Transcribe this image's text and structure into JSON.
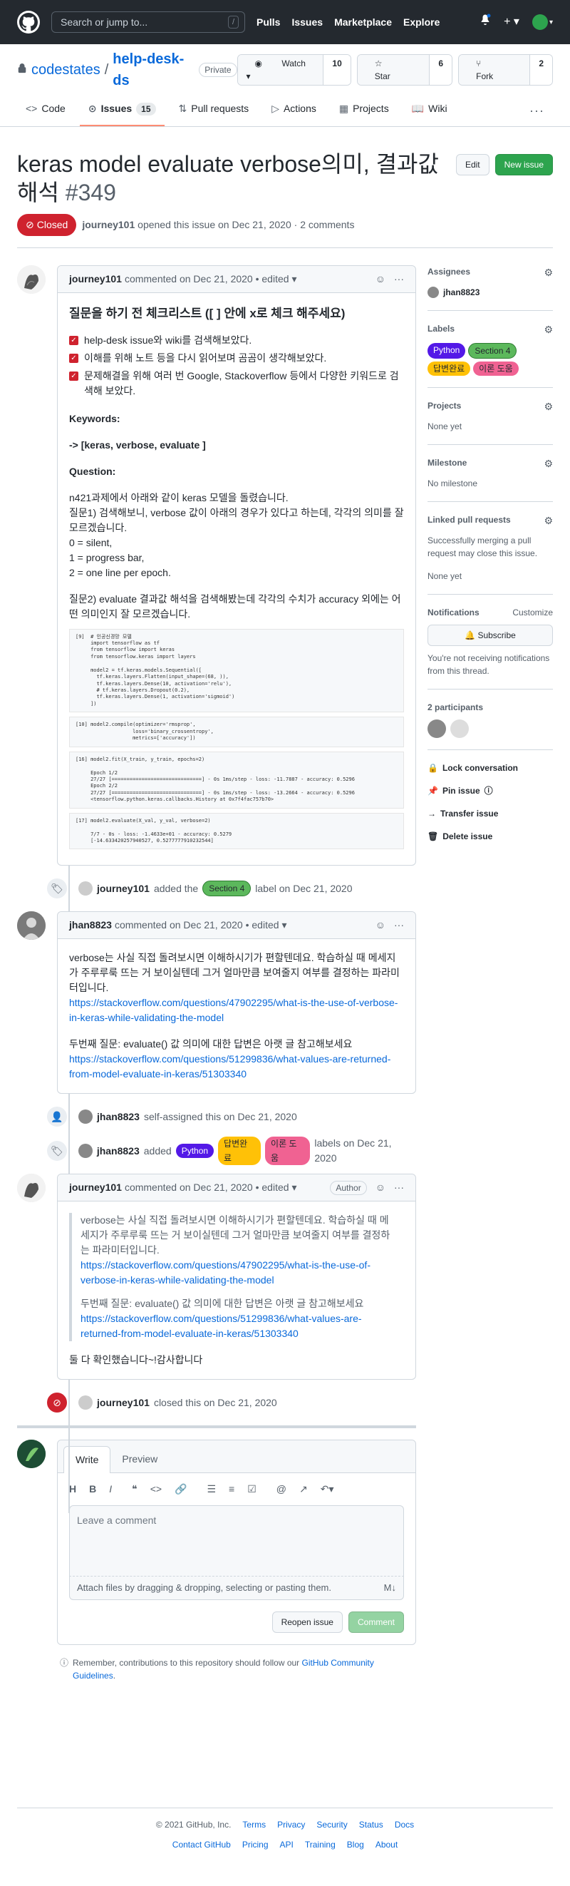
{
  "header": {
    "search_placeholder": "Search or jump to...",
    "slash": "/",
    "nav": [
      "Pulls",
      "Issues",
      "Marketplace",
      "Explore"
    ]
  },
  "repo": {
    "owner": "codestates",
    "sep": "/",
    "name": "help-desk-ds",
    "visibility": "Private",
    "watch_label": "Watch",
    "watch_count": "10",
    "star_label": "Star",
    "star_count": "6",
    "fork_label": "Fork",
    "fork_count": "2",
    "tabs": [
      {
        "label": "Code",
        "icon": "code-icon"
      },
      {
        "label": "Issues",
        "icon": "issue-icon",
        "counter": "15"
      },
      {
        "label": "Pull requests",
        "icon": "pull-request-icon"
      },
      {
        "label": "Actions",
        "icon": "play-icon"
      },
      {
        "label": "Projects",
        "icon": "project-icon"
      },
      {
        "label": "Wiki",
        "icon": "book-icon"
      }
    ]
  },
  "issue": {
    "title": "keras model evaluate verbose의미, 결과값 해석",
    "number": "#349",
    "edit_label": "Edit",
    "new_issue_label": "New issue",
    "state": "Closed",
    "author": "journey101",
    "opened_text": "opened this issue on Dec 21, 2020 · 2 comments"
  },
  "comments": {
    "first": {
      "author": "journey101",
      "meta": "commented on Dec 21, 2020 • edited",
      "heading": "질문을 하기 전 체크리스트 ([ ] 안에 x로 체크 해주세요)",
      "tasks": [
        "help-desk issue와 wiki를 검색해보았다.",
        "이해를 위해 노트 등을 다시 읽어보며 곰곰이 생각해보았다.",
        "문제해결을 위해 여러 번 Google, Stackoverflow 등에서 다양한 키워드로 검색해 보았다."
      ],
      "keywords_h": "Keywords:",
      "keywords": "-> [keras, verbose, evaluate ]",
      "question_h": "Question:",
      "q_lines": [
        "n421과제에서 아래와 같이 keras 모델을 돌렸습니다.",
        "질문1) 검색해보니, verbose 값이 아래의 경우가 있다고 하는데, 각각의 의미를 잘 모르겠습니다.",
        "0 = silent,",
        "1 = progress bar,",
        "2 = one line per epoch."
      ],
      "q2": "질문2) evaluate 결과값 해석을 검색해봤는데 각각의 수치가 accuracy 외에는 어떤 의미인지 잘 모르겠습니다."
    },
    "second": {
      "author": "jhan8823",
      "meta": "commented on Dec 21, 2020 • edited",
      "p1": "verbose는 사실 직접 돌려보시면 이해하시기가 편할텐데요. 학습하실 때 메세지가 주루루룩 뜨는 거 보이실텐데 그거 얼마만큼 보여줄지 여부를 결정하는 파라미터입니다.",
      "link1": "https://stackoverflow.com/questions/47902295/what-is-the-use-of-verbose-in-keras-while-validating-the-model",
      "p2": "두번째 질문: evaluate() 값 의미에 대한 답변은 아랫 글 참고해보세요",
      "link2": "https://stackoverflow.com/questions/51299836/what-values-are-returned-from-model-evaluate-in-keras/51303340"
    },
    "third": {
      "author": "journey101",
      "meta": "commented on Dec 21, 2020 • edited",
      "badge": "Author",
      "q1": "verbose는 사실 직접 돌려보시면 이해하시기가 편할텐데요. 학습하실 때 메세지가 주루루룩 뜨는 거 보이실텐데 그거 얼마만큼 보여줄지 여부를 결정하는 파라미터입니다.",
      "qlink1": "https://stackoverflow.com/questions/47902295/what-is-the-use-of-verbose-in-keras-while-validating-the-model",
      "q2": "두번째 질문: evaluate() 값 의미에 대한 답변은 아랫 글 참고해보세요",
      "qlink2": "https://stackoverflow.com/questions/51299836/what-values-are-returned-from-model-evaluate-in-keras/51303340",
      "reply": "둘 다 확인했습니다~!감사합니다"
    }
  },
  "code": {
    "cell1": [
      "[9]  # 인공신경망 모델",
      "     import tensorflow as tf",
      "     from tensorflow import keras",
      "     from tensorflow.keras import layers",
      "",
      "     model2 = tf.keras.models.Sequential([",
      "       tf.keras.layers.Flatten(input_shape=(68, )),",
      "       tf.keras.layers.Dense(10, activation='relu'),",
      "       # tf.keras.layers.Dropout(0.2),",
      "       tf.keras.layers.Dense(1, activation='sigmoid')",
      "     ])"
    ],
    "cell2": [
      "[10] model2.compile(optimizer='rmsprop',",
      "                   loss='binary_crossentropy',",
      "                   metrics=['accuracy'])"
    ],
    "cell3": [
      "[16] model2.fit(X_train, y_train, epochs=2)",
      "",
      "     Epoch 1/2",
      "     27/27 [==============================] - 0s 1ms/step - loss: -11.7887 - accuracy: 0.5296",
      "     Epoch 2/2",
      "     27/27 [==============================] - 0s 1ms/step - loss: -13.2664 - accuracy: 0.5296",
      "     <tensorflow.python.keras.callbacks.History at 0x7f4fac757b70>"
    ],
    "cell4": [
      "[17] model2.evaluate(X_val, y_val, verbose=2)",
      "",
      "     7/7 - 0s - loss: -1.4633e+01 - accuracy: 0.5279",
      "     [-14.633420257940527, 0.5277777910232544]"
    ]
  },
  "events": {
    "label_added": {
      "actor": "journey101",
      "pre": "added the",
      "label": "Section 4",
      "post": "label on Dec 21, 2020"
    },
    "self_assigned": {
      "actor": "jhan8823",
      "text": "self-assigned this on Dec 21, 2020"
    },
    "labels_added": {
      "actor": "jhan8823",
      "pre": "added",
      "labels": [
        "Python",
        "답변완료",
        "이론 도움"
      ],
      "post": "labels on Dec 21, 2020"
    },
    "closed": {
      "actor": "journey101",
      "text": "closed this on Dec 21, 2020"
    }
  },
  "new_comment": {
    "tab_write": "Write",
    "tab_preview": "Preview",
    "placeholder": "Leave a comment",
    "attach": "Attach files by dragging & dropping, selecting or pasting them.",
    "reopen_label": "Reopen issue",
    "comment_label": "Comment",
    "tip_pre": "Remember, contributions to this repository should follow our",
    "tip_link": "GitHub Community Guidelines",
    "tip_post": "."
  },
  "sidebar": {
    "assignees_h": "Assignees",
    "assignee": "jhan8823",
    "labels_h": "Labels",
    "labels": [
      {
        "text": "Python",
        "color": "#5319e7"
      },
      {
        "text": "Section 4",
        "color": "#5cb85c"
      },
      {
        "text": "답변완료",
        "color": "#ffc107"
      },
      {
        "text": "이론 도움",
        "color": "#f06292"
      }
    ],
    "projects_h": "Projects",
    "projects_val": "None yet",
    "milestone_h": "Milestone",
    "milestone_val": "No milestone",
    "linked_h": "Linked pull requests",
    "linked_desc": "Successfully merging a pull request may close this issue.",
    "linked_val": "None yet",
    "notif_h": "Notifications",
    "customize": "Customize",
    "subscribe": "Subscribe",
    "notif_desc": "You're not receiving notifications from this thread.",
    "participants_h": "2 participants",
    "lock": "Lock conversation",
    "pin": "Pin issue",
    "transfer": "Transfer issue",
    "delete": "Delete issue"
  },
  "footer": {
    "copyright": "© 2021 GitHub, Inc.",
    "row1": [
      "Terms",
      "Privacy",
      "Security",
      "Status",
      "Docs"
    ],
    "row2": [
      "Contact GitHub",
      "Pricing",
      "API",
      "Training",
      "Blog",
      "About"
    ]
  }
}
